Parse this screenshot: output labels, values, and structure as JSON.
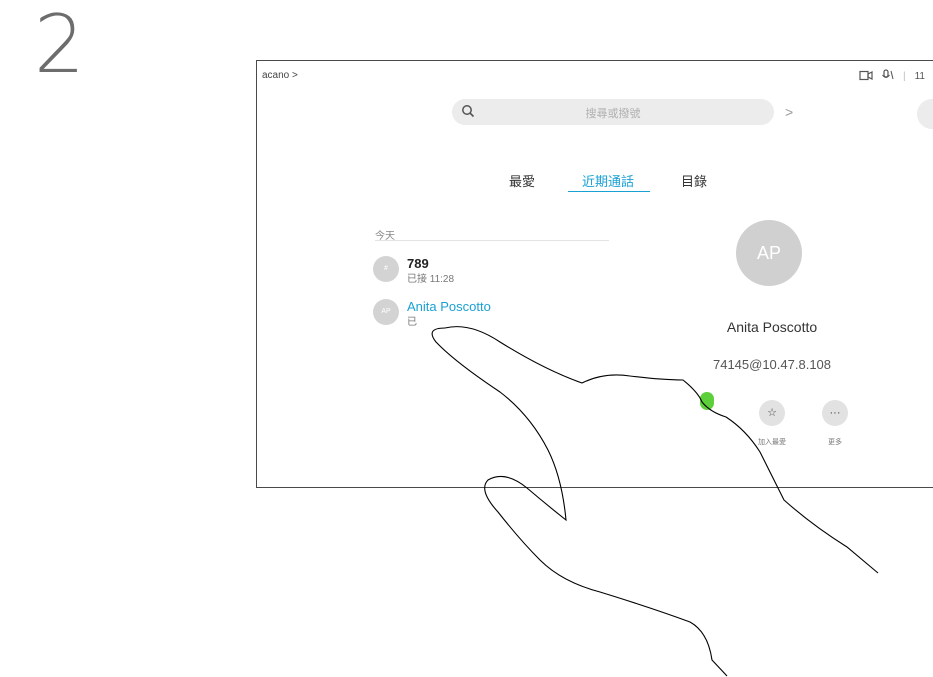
{
  "step_number": "2",
  "header": {
    "brand": "acano >",
    "status_icons": [
      "camera-icon",
      "mic-icon"
    ],
    "time": "11"
  },
  "search": {
    "placeholder": "搜尋或撥號"
  },
  "tabs": [
    {
      "label": "最愛",
      "active": false
    },
    {
      "label": "近期通話",
      "active": true
    },
    {
      "label": "目錄",
      "active": false
    }
  ],
  "recents": {
    "section_title": "今天",
    "items": [
      {
        "avatar": "#",
        "name": "789",
        "detail": "已接 11:28"
      },
      {
        "avatar": "AP",
        "name": "Anita Poscotto",
        "detail": "已"
      }
    ]
  },
  "detail": {
    "avatar": "AP",
    "name": "Anita Poscotto",
    "address": "74145@10.47.8.108",
    "actions": [
      {
        "icon": "star-icon",
        "glyph": "☆",
        "label": "加入最愛"
      },
      {
        "icon": "more-icon",
        "glyph": "···",
        "label": "更多"
      }
    ]
  },
  "colors": {
    "accent": "#1aa1d4",
    "call_green": "#5ccf3a"
  }
}
